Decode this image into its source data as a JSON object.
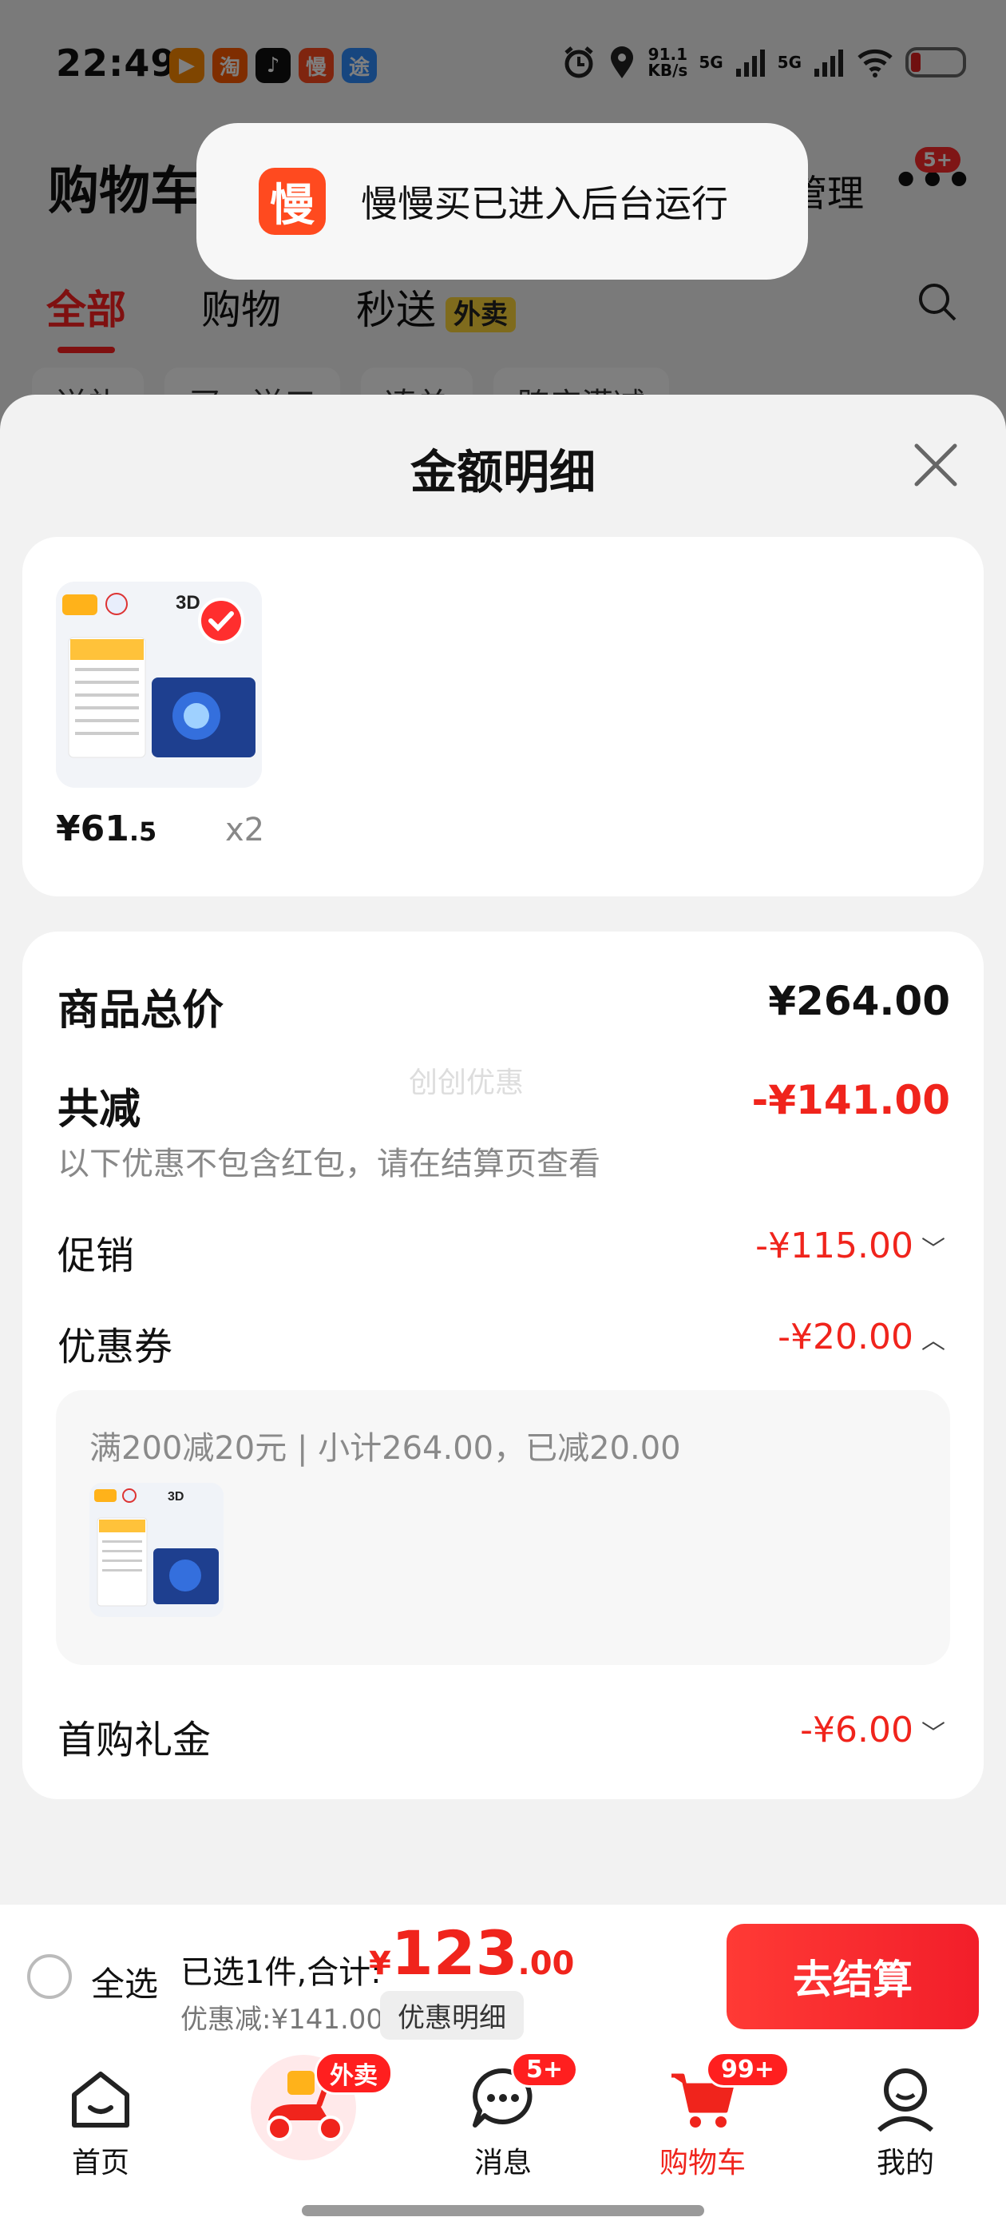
{
  "status_bar": {
    "time": "22:49",
    "apps": [
      {
        "name": "video-app-icon",
        "glyph": "▶",
        "color": "#ff8a00"
      },
      {
        "name": "taobao-icon",
        "glyph": "淘",
        "color": "#ff5a00"
      },
      {
        "name": "tiktok-icon",
        "glyph": "♪",
        "color": "#111111"
      },
      {
        "name": "manmanmai-icon",
        "glyph": "慢",
        "color": "#ff4a1f"
      },
      {
        "name": "app-tu-icon",
        "glyph": "途",
        "color": "#2f8cff"
      }
    ],
    "net_speed_top": "91.1",
    "net_speed_bottom": "KB/s",
    "sim1": "5G",
    "sim2": "5G"
  },
  "background": {
    "title": "购物车",
    "manage": "管理",
    "more_badge": "5+",
    "tabs": [
      "全部",
      "购物",
      "秒送"
    ],
    "waimai_tag": "外卖",
    "chips": [
      "送礼",
      "买一送三",
      "凑单",
      "跨店满减"
    ]
  },
  "toast": {
    "icon_glyph": "慢",
    "text": "慢慢买已进入后台运行"
  },
  "sheet": {
    "title": "金额明细",
    "product": {
      "price_main": "¥61",
      "price_decimal": ".5",
      "quantity": "x2"
    },
    "watermark": "创创优惠",
    "rows": {
      "total_label": "商品总价",
      "total_value": "¥264.00",
      "reduce_label": "共减",
      "reduce_value": "-¥141.00",
      "reduce_note": "以下优惠不包含红包，请在结算页查看",
      "promo_label": "促销",
      "promo_value": "-¥115.00",
      "coupon_label": "优惠券",
      "coupon_value": "-¥20.00",
      "first_buy_label": "首购礼金",
      "first_buy_value": "-¥6.00"
    },
    "coupon_detail": "满200减20元 | 小计264.00，已减20.00"
  },
  "checkout": {
    "select_all": "全选",
    "selected_prefix": "已选1件,合计:",
    "yen": "¥",
    "amount_int": "123",
    "amount_dec": ".00",
    "discount": "优惠减:¥141.00",
    "detail_chip": "优惠明细",
    "checkout_btn": "去结算"
  },
  "nav": {
    "home": "首页",
    "waimai_badge": "外卖",
    "messages": "消息",
    "messages_badge": "5+",
    "cart": "购物车",
    "cart_badge": "99+",
    "mine": "我的"
  },
  "colors": {
    "accent_red": "#f0241c",
    "toast_icon": "#ff4a1f",
    "waimai_yellow": "#ffd73a"
  }
}
